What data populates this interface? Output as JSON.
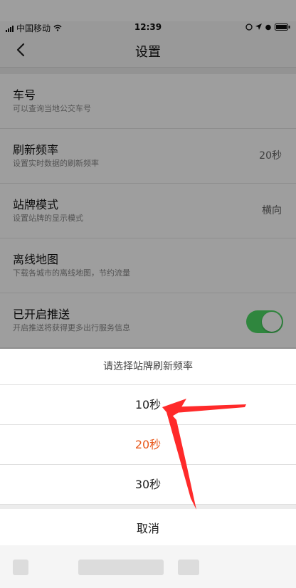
{
  "status": {
    "carrier": "中国移动",
    "time": "12:39"
  },
  "nav": {
    "title": "设置"
  },
  "settings": [
    {
      "title": "车号",
      "subtitle": "可以查询当地公交车号",
      "value": ""
    },
    {
      "title": "刷新频率",
      "subtitle": "设置实时数据的刷新频率",
      "value": "20秒"
    },
    {
      "title": "站牌模式",
      "subtitle": "设置站牌的显示模式",
      "value": "横向"
    },
    {
      "title": "离线地图",
      "subtitle": "下载各城市的离线地图，节约流量",
      "value": ""
    },
    {
      "title": "已开启推送",
      "subtitle": "开启推送将获得更多出行服务信息",
      "value": "",
      "toggle_on": true
    }
  ],
  "sheet": {
    "title": "请选择站牌刷新频率",
    "options": [
      "10秒",
      "20秒",
      "30秒"
    ],
    "selected_index": 1,
    "cancel_label": "取消"
  },
  "colors": {
    "selected": "#e8591c",
    "toggle": "#4cd964",
    "annotation_arrow": "#ff2a2a"
  }
}
